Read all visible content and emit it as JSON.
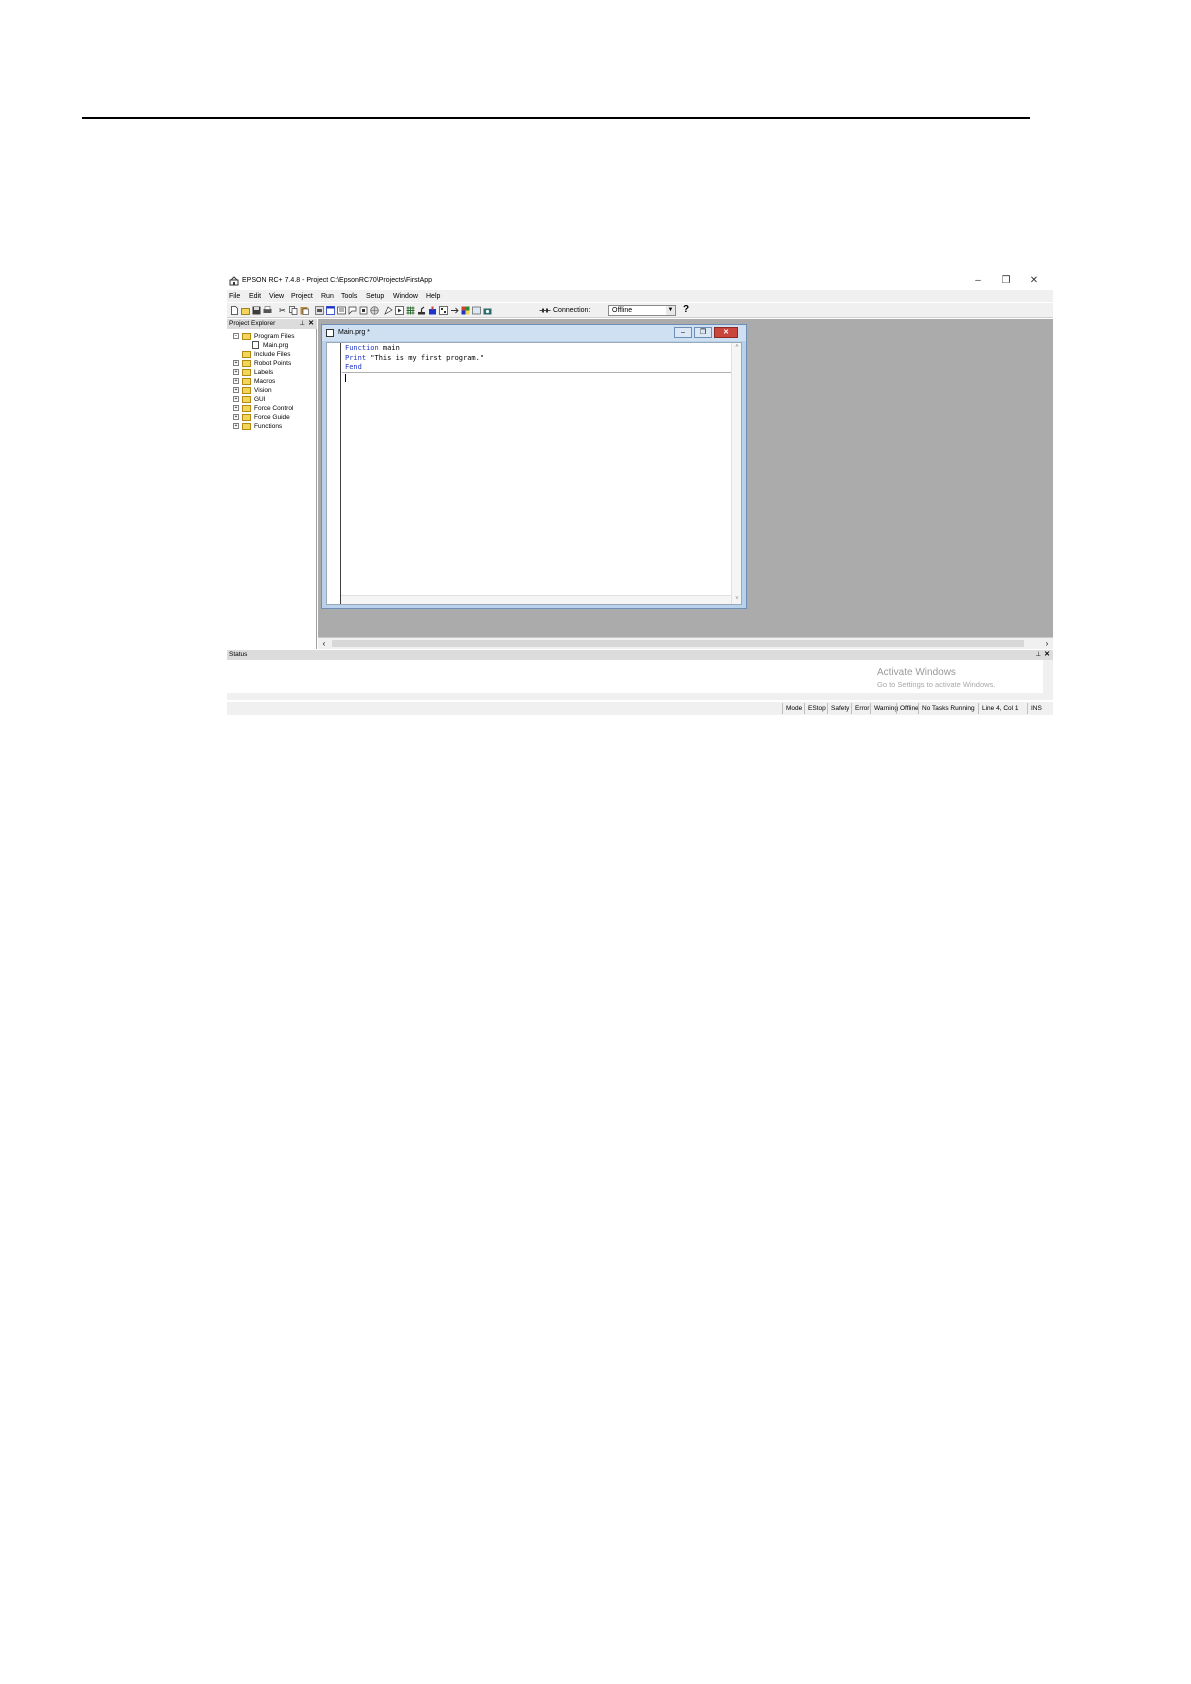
{
  "window": {
    "title": "EPSON RC+ 7.4.8 - Project C:\\EpsonRC70\\Projects\\FirstApp"
  },
  "menu": [
    "File",
    "Edit",
    "View",
    "Project",
    "Run",
    "Tools",
    "Setup",
    "Window",
    "Help"
  ],
  "toolbar": {
    "connection_label": "Connection:",
    "connection_value": "Offline",
    "help_label": "?"
  },
  "explorer": {
    "title": "Project Explorer",
    "items": [
      {
        "label": "Program Files",
        "expander": "−"
      },
      {
        "label": "Main.prg",
        "expander": ""
      },
      {
        "label": "Include Files",
        "expander": ""
      },
      {
        "label": "Robot Points",
        "expander": "+"
      },
      {
        "label": "Labels",
        "expander": "+"
      },
      {
        "label": "Macros",
        "expander": "+"
      },
      {
        "label": "Vision",
        "expander": "+"
      },
      {
        "label": "GUI",
        "expander": "+"
      },
      {
        "label": "Force Control",
        "expander": "+"
      },
      {
        "label": "Force Guide",
        "expander": "+"
      },
      {
        "label": "Functions",
        "expander": "+"
      }
    ]
  },
  "editor": {
    "title": "Main.prg *",
    "code": {
      "line1_kw": "Function",
      "line1_rest": " main",
      "line2_kw": "Print",
      "line2_rest": " \"This is my first program.\"",
      "line3_kw": "Fend"
    }
  },
  "status": {
    "title": "Status",
    "watermark_title": "Activate Windows",
    "watermark_sub": "Go to Settings to activate Windows."
  },
  "statusbar": {
    "mode": "Mode",
    "estop": "EStop",
    "safety": "Safety",
    "error": "Error",
    "warning": "Warning",
    "offline": "Offline",
    "tasks": "No Tasks Running",
    "position": "Line 4, Col 1",
    "ins": "INS"
  },
  "colors": {
    "keyword": "#1c34c7",
    "mdi_background": "#ababab",
    "editor_frame": "#b9d1ea",
    "folder": "#f2d55a"
  }
}
